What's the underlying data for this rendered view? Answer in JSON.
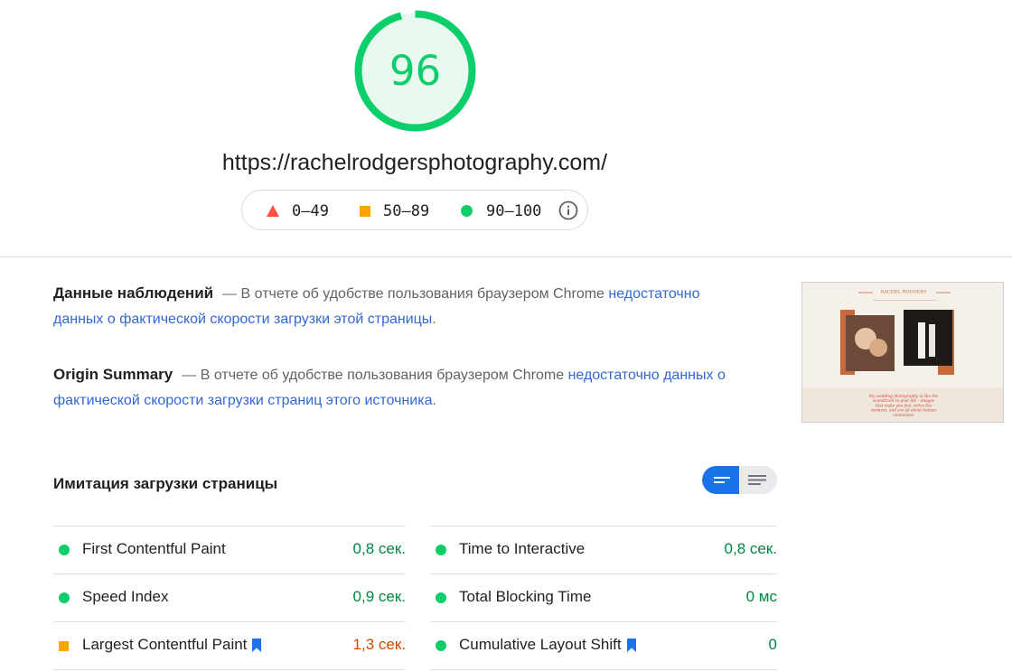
{
  "header": {
    "score": "96",
    "score_fraction": 0.96,
    "url": "https://rachelrodgersphotography.com/",
    "legend": {
      "fail": "0–49",
      "average": "50–89",
      "pass": "90–100"
    }
  },
  "field_data": {
    "title": "Данные наблюдений",
    "text": "— В отчете об удобстве пользования браузером Chrome ",
    "link": "недостаточно данных о фактической скорости загрузки этой страницы",
    "end": "."
  },
  "origin_summary": {
    "title": "Origin Summary",
    "text": "— В отчете об удобстве пользования браузером Chrome ",
    "link": "недостаточно данных о фактической скорости загрузки страниц этого источника",
    "end": "."
  },
  "lab": {
    "title": "Имитация загрузки страницы",
    "left": [
      {
        "label": "First Contentful Paint",
        "value": "0,8 сек.",
        "status": "good",
        "bookmark": false
      },
      {
        "label": "Speed Index",
        "value": "0,9 сек.",
        "status": "good",
        "bookmark": false
      },
      {
        "label": "Largest Contentful Paint",
        "value": "1,3 сек.",
        "status": "average",
        "bookmark": true
      }
    ],
    "right": [
      {
        "label": "Time to Interactive",
        "value": "0,8 сек.",
        "status": "good",
        "bookmark": false
      },
      {
        "label": "Total Blocking Time",
        "value": "0 мс",
        "status": "good",
        "bookmark": false
      },
      {
        "label": "Cumulative Layout Shift",
        "value": "0",
        "status": "good",
        "bookmark": true
      }
    ]
  },
  "thumbnail": {
    "brand": "RACHEL RODGERS",
    "caption": "My wedding photography is like the soundtrack to your life – images that make you feel, relive the moment, and are all about human connection"
  },
  "colors": {
    "pass": "#0cce6b",
    "average": "#ffa400",
    "fail": "#ff4e42",
    "link": "#3367d6",
    "toggle_active": "#1a73e8"
  }
}
